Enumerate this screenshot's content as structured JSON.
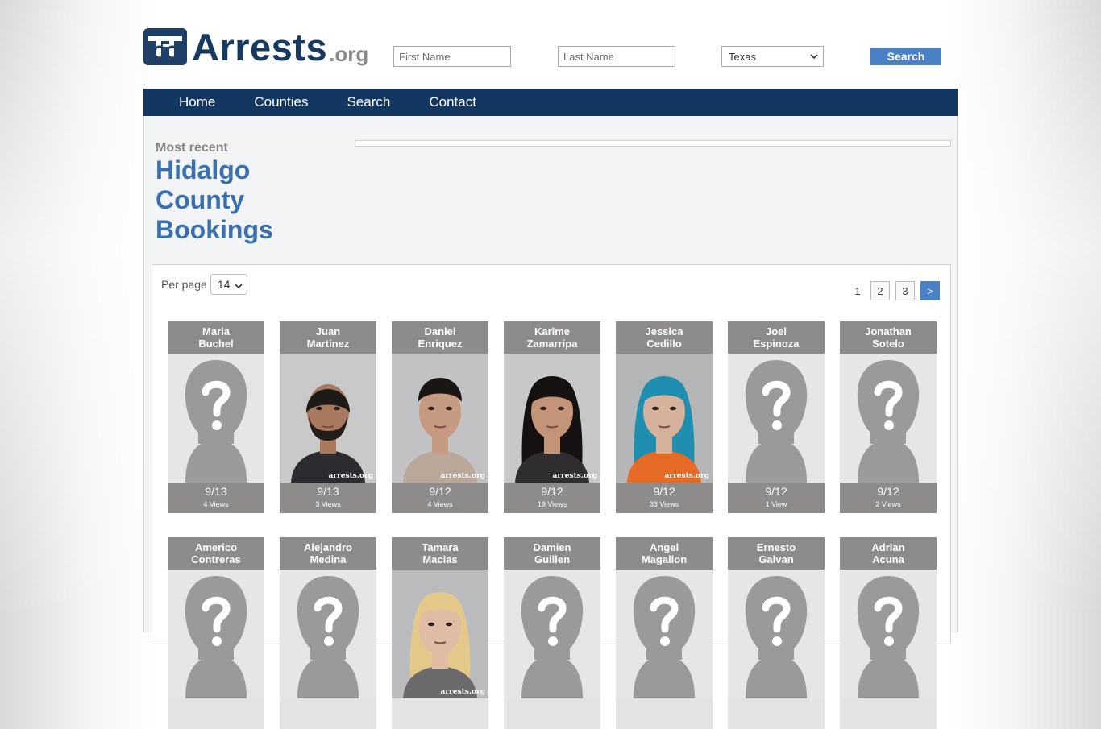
{
  "site": {
    "logo_text": "Arrests",
    "logo_suffix": ".org"
  },
  "search": {
    "first_name_placeholder": "First Name",
    "last_name_placeholder": "Last Name",
    "state_selected": "Texas",
    "button_label": "Search"
  },
  "nav": {
    "items": [
      {
        "label": "Home"
      },
      {
        "label": "Counties"
      },
      {
        "label": "Search"
      },
      {
        "label": "Contact"
      }
    ]
  },
  "main": {
    "kicker": "Most recent",
    "heading_line1": "Hidalgo",
    "heading_line2": "County",
    "heading_line3": "Bookings"
  },
  "listing": {
    "per_page_label": "Per page",
    "per_page_value": "14",
    "pages": [
      "1",
      "2",
      "3"
    ],
    "next_label": ">",
    "watermark": "arrests.org",
    "row1": [
      {
        "first": "Maria",
        "last": "Buchel",
        "date": "9/13",
        "views": "4 Views",
        "photo": "placeholder"
      },
      {
        "first": "Juan",
        "last": "Martinez",
        "date": "9/13",
        "views": "3 Views",
        "photo": "mugshot-man-beard"
      },
      {
        "first": "Daniel",
        "last": "Enriquez",
        "date": "9/12",
        "views": "4 Views",
        "photo": "mugshot-young-man"
      },
      {
        "first": "Karime",
        "last": "Zamarripa",
        "date": "9/12",
        "views": "19 Views",
        "photo": "mugshot-woman-dark-hair"
      },
      {
        "first": "Jessica",
        "last": "Cedillo",
        "date": "9/12",
        "views": "33 Views",
        "photo": "mugshot-woman-blue-hair"
      },
      {
        "first": "Joel",
        "last": "Espinoza",
        "date": "9/12",
        "views": "1 View",
        "photo": "placeholder"
      },
      {
        "first": "Jonathan",
        "last": "Sotelo",
        "date": "9/12",
        "views": "2 Views",
        "photo": "placeholder"
      }
    ],
    "row2": [
      {
        "first": "Americo",
        "last": "Contreras",
        "photo": "placeholder"
      },
      {
        "first": "Alejandro",
        "last": "Medina",
        "photo": "placeholder"
      },
      {
        "first": "Tamara",
        "last": "Macias",
        "photo": "mugshot-woman-blonde"
      },
      {
        "first": "Damien",
        "last": "Guillen",
        "photo": "placeholder"
      },
      {
        "first": "Angel",
        "last": "Magallon",
        "photo": "placeholder"
      },
      {
        "first": "Ernesto",
        "last": "Galvan",
        "photo": "placeholder"
      },
      {
        "first": "Adrian",
        "last": "Acuna",
        "photo": "placeholder"
      }
    ]
  }
}
